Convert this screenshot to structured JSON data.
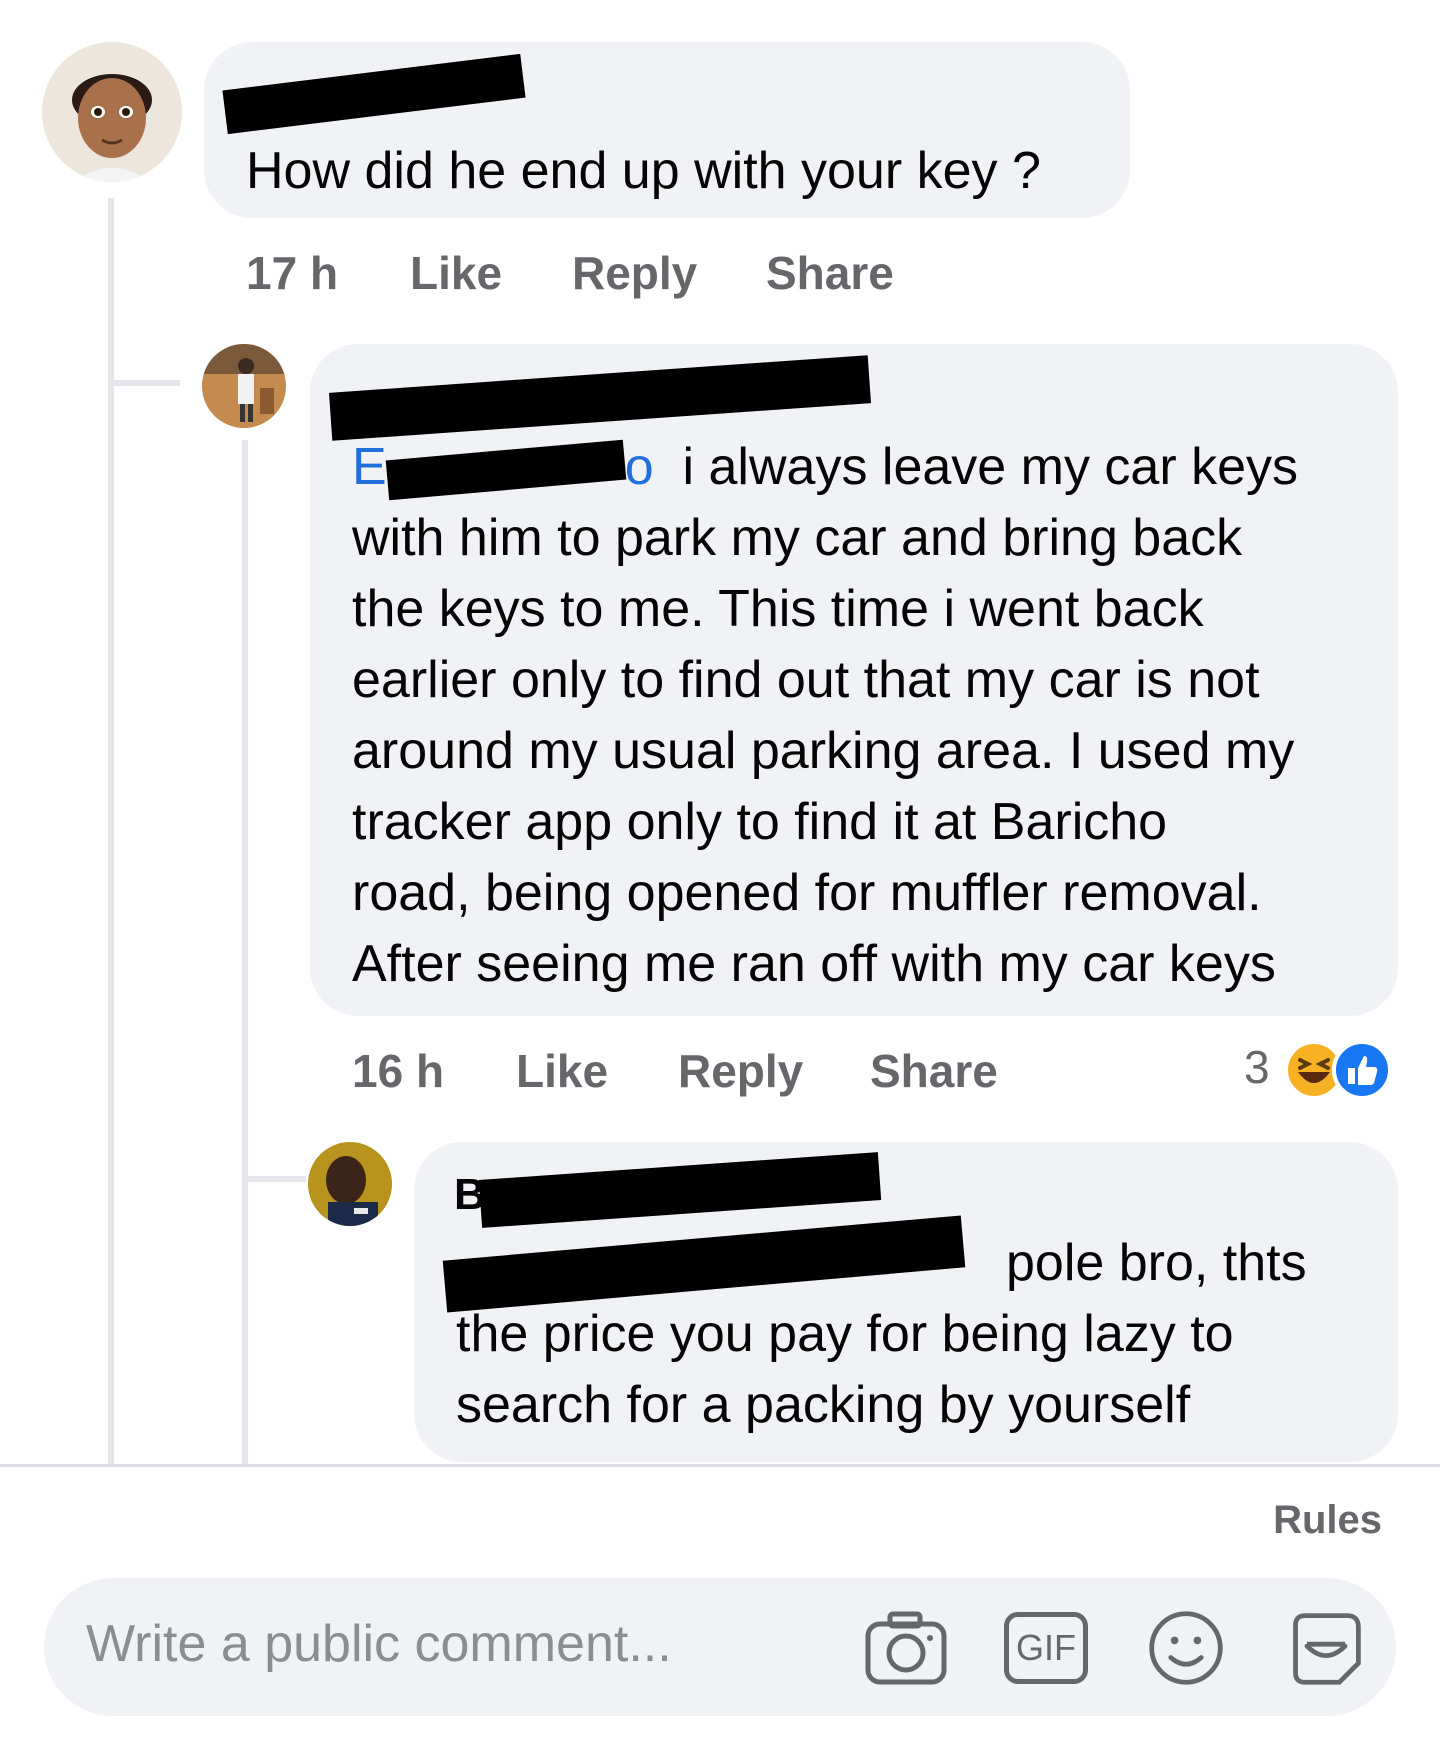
{
  "comment1": {
    "author": "",
    "text": "How did he end up with your key ?",
    "time": "17 h",
    "like": "Like",
    "reply": "Reply",
    "share": "Share"
  },
  "comment2": {
    "mention": "E",
    "mention_tail": "o",
    "lines": [
      "i always leave my car keys",
      "with him to park my car and bring back",
      "the keys to me. This time i went back",
      "earlier only to find out that my car is not",
      "around my usual parking area. I used my",
      "tracker app only to find it at Baricho",
      "road, being opened for muffler removal.",
      "After seeing me ran off with my car keys"
    ],
    "time": "16 h",
    "like": "Like",
    "reply": "Reply",
    "share": "Share",
    "reaction_count": "3",
    "reactions": [
      "haha-icon",
      "like-icon"
    ]
  },
  "comment3": {
    "author_initial": "B",
    "lines": [
      "pole bro, thts",
      "the price you pay for being lazy to",
      "search for a packing by yourself"
    ]
  },
  "footer": {
    "rules": "Rules",
    "composer_placeholder": "Write a public comment...",
    "icons": [
      "camera-icon",
      "gif-icon",
      "emoji-icon",
      "sticker-icon"
    ],
    "gif_label": "GIF"
  },
  "colors": {
    "bubble": "#f0f2f5",
    "mention": "#216fdb",
    "meta": "#65676b"
  }
}
